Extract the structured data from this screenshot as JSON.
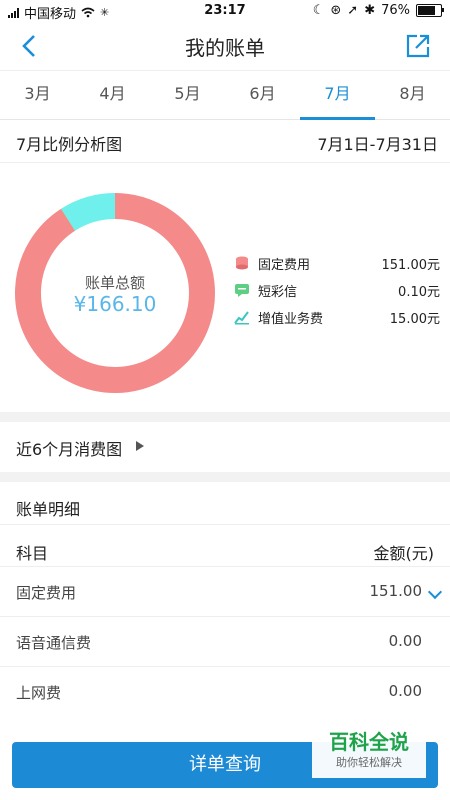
{
  "status": {
    "carrier": "中国移动",
    "time": "23:17",
    "battery": "76%",
    "battery_level": 0.76
  },
  "header": {
    "title": "我的账单"
  },
  "months": [
    {
      "label": "3月",
      "active": false
    },
    {
      "label": "4月",
      "active": false
    },
    {
      "label": "5月",
      "active": false
    },
    {
      "label": "6月",
      "active": false
    },
    {
      "label": "7月",
      "active": true
    },
    {
      "label": "8月",
      "active": false
    }
  ],
  "analysis": {
    "title": "7月比例分析图",
    "date_range": "7月1日-7月31日"
  },
  "chart_data": {
    "type": "pie",
    "center_label": "账单总额",
    "center_value": "¥166.10",
    "slices": [
      {
        "label": "固定费用",
        "value": 151.0,
        "display": "151.00元",
        "color": "#f58a8a"
      },
      {
        "label": "短彩信",
        "value": 0.1,
        "display": "0.10元",
        "color": "#5ccf85"
      },
      {
        "label": "增值业务费",
        "value": 15.0,
        "display": "15.00元",
        "color": "#6ff0ec"
      }
    ]
  },
  "recent": {
    "label": "近6个月消费图"
  },
  "detail": {
    "title": "账单明细",
    "col_item": "科目",
    "col_amount": "金额(元)",
    "rows": [
      {
        "item": "固定费用",
        "amount": "151.00"
      },
      {
        "item": "语音通信费",
        "amount": "0.00"
      },
      {
        "item": "上网费",
        "amount": "0.00"
      }
    ]
  },
  "footer": {
    "button": "详单查询"
  },
  "watermark": {
    "line1": "百科全说",
    "line2": "助你轻松解决"
  }
}
